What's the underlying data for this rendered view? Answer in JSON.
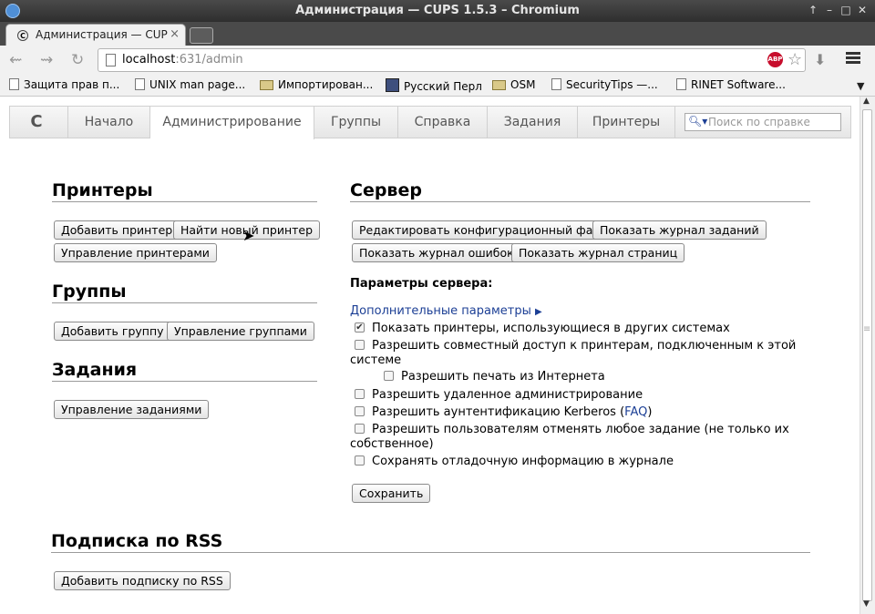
{
  "window": {
    "title": "Администрация — CUPS 1.5.3 – Chromium"
  },
  "tab": {
    "title": "Администрация — CUPS"
  },
  "address": {
    "host": "localhost",
    "path": ":631/admin"
  },
  "bookmarks": [
    {
      "label": "Защита прав п...",
      "icon": "page-icon"
    },
    {
      "label": "UNIX man page...",
      "icon": "page-icon"
    },
    {
      "label": "Импортирован...",
      "icon": "folder-icon"
    },
    {
      "label": "Русский Перл",
      "icon": "image-icon"
    },
    {
      "label": "OSM",
      "icon": "folder-icon"
    },
    {
      "label": "SecurityTips —...",
      "icon": "page-icon"
    },
    {
      "label": "RINET Software...",
      "icon": "page-icon"
    }
  ],
  "nav": {
    "items": [
      "Начало",
      "Администрирование",
      "Группы",
      "Справка",
      "Задания",
      "Принтеры"
    ],
    "active": "Администрирование",
    "search_placeholder": "Поиск по справке"
  },
  "printers": {
    "heading": "Принтеры",
    "add": "Добавить принтер",
    "find": "Найти новый принтер",
    "manage": "Управление принтерами"
  },
  "groups": {
    "heading": "Группы",
    "add": "Добавить группу",
    "manage": "Управление группами"
  },
  "jobs": {
    "heading": "Задания",
    "manage": "Управление заданиями"
  },
  "server": {
    "heading": "Сервер",
    "edit_config": "Редактировать конфигурационный файл",
    "show_job_log": "Показать журнал заданий",
    "show_error_log": "Показать журнал ошибок",
    "show_page_log": "Показать журнал страниц",
    "settings_label": "Параметры сервера:",
    "advanced_link": "Дополнительные параметры",
    "options": {
      "share_remote": {
        "text": "Показать принтеры, использующиеся в других системах",
        "checked": true
      },
      "share_local": {
        "text": "Разрешить совместный доступ к принтерам, подключенным к этой системе",
        "checked": false
      },
      "internet": {
        "text": "Разрешить печать из Интернета",
        "checked": false
      },
      "remote_admin": {
        "text": "Разрешить удаленное администрирование",
        "checked": false
      },
      "kerberos_pre": "Разрешить аунтентификацию Kerberos (",
      "kerberos_link": "FAQ",
      "kerberos_post": ")",
      "kerberos_checked": false,
      "cancel_any": {
        "text": "Разрешить пользователям отменять любое задание (не только их собственное)",
        "checked": false
      },
      "debug": {
        "text": "Сохранять отладочную информацию в журнале",
        "checked": false
      }
    },
    "save": "Сохранить"
  },
  "rss": {
    "heading": "Подписка по RSS",
    "add": "Добавить подписку по RSS"
  }
}
